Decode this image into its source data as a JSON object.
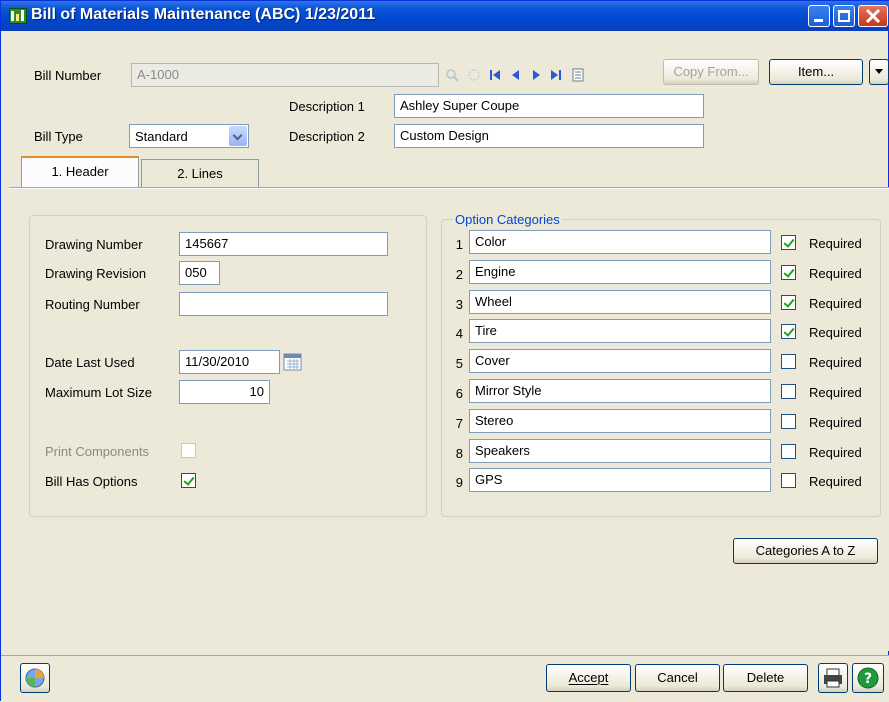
{
  "window": {
    "title": "Bill of Materials Maintenance (ABC) 1/23/2011"
  },
  "header": {
    "bill_number_label": "Bill Number",
    "bill_number_value": "A-1000",
    "copy_from_label": "Copy From...",
    "item_label": "Item...",
    "description1_label": "Description 1",
    "description1_value": "Ashley Super Coupe",
    "description2_label": "Description 2",
    "description2_value": "Custom Design",
    "bill_type_label": "Bill Type",
    "bill_type_value": "Standard"
  },
  "tabs": [
    {
      "label": "1. Header",
      "active": true
    },
    {
      "label": "2. Lines",
      "active": false
    }
  ],
  "header_tab": {
    "drawing_number_label": "Drawing Number",
    "drawing_number_value": "145667",
    "drawing_revision_label": "Drawing Revision",
    "drawing_revision_value": "050",
    "routing_number_label": "Routing Number",
    "routing_number_value": "",
    "date_last_used_label": "Date Last Used",
    "date_last_used_value": "11/30/2010",
    "max_lot_size_label": "Maximum Lot Size",
    "max_lot_size_value": "10",
    "print_components_label": "Print Components",
    "print_components_checked": false,
    "bill_has_options_label": "Bill Has Options",
    "bill_has_options_checked": true
  },
  "option_categories": {
    "title": "Option Categories",
    "required_label": "Required",
    "items": [
      {
        "num": "1",
        "name": "Color",
        "required": true
      },
      {
        "num": "2",
        "name": "Engine",
        "required": true
      },
      {
        "num": "3",
        "name": "Wheel",
        "required": true
      },
      {
        "num": "4",
        "name": "Tire",
        "required": true
      },
      {
        "num": "5",
        "name": "Cover",
        "required": false
      },
      {
        "num": "6",
        "name": "Mirror Style",
        "required": false
      },
      {
        "num": "7",
        "name": "Stereo",
        "required": false
      },
      {
        "num": "8",
        "name": "Speakers",
        "required": false
      },
      {
        "num": "9",
        "name": "GPS",
        "required": false
      }
    ],
    "sort_button_label": "Categories A to Z"
  },
  "footer": {
    "accept_label": "Accept",
    "cancel_label": "Cancel",
    "delete_label": "Delete"
  },
  "icons": {
    "app": "bom-app-icon",
    "calendar": "calendar-icon",
    "print": "printer-icon",
    "help": "help-icon",
    "customize": "customizer-icon"
  },
  "colors": {
    "titlebar": "#0a56d8",
    "group_title": "#0046d5",
    "check": "#21a121"
  }
}
